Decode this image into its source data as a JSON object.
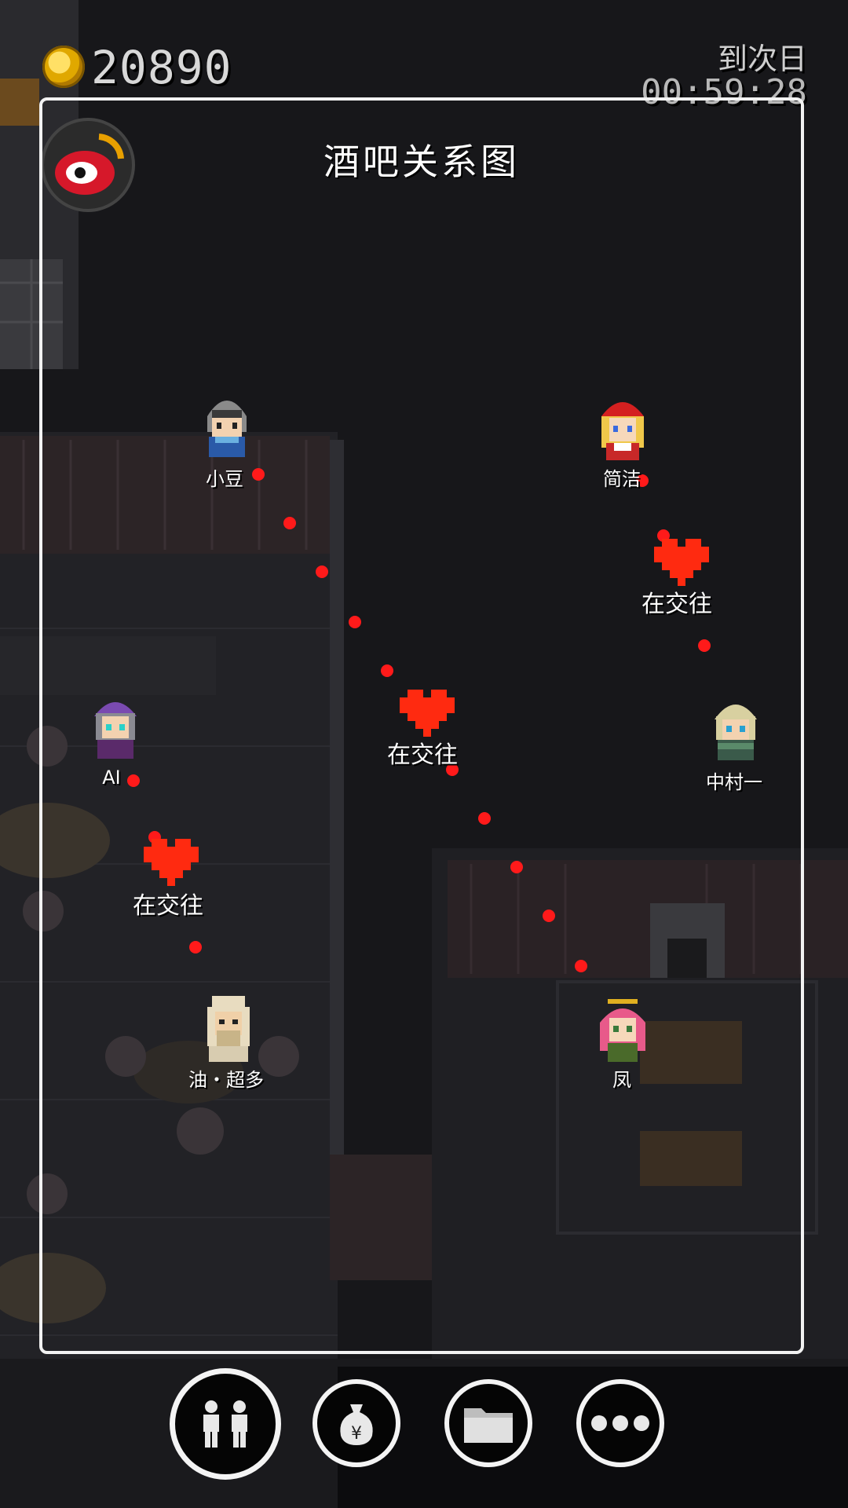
{
  "hud": {
    "coins": "20890",
    "timer_label": "到次日",
    "timer_value": "00:59:28"
  },
  "panel": {
    "title": "酒吧关系图"
  },
  "characters": [
    {
      "name": "小豆"
    },
    {
      "name": "简洁"
    },
    {
      "name": "AI"
    },
    {
      "name": "中村一"
    },
    {
      "name": "油・超多"
    },
    {
      "name": "凤"
    }
  ],
  "relationships": [
    {
      "from": "小豆",
      "to": "凤",
      "label": "在交往"
    },
    {
      "from": "简洁",
      "to": "中村一",
      "label": "在交往"
    },
    {
      "from": "AI",
      "to": "油・超多",
      "label": "在交往"
    }
  ],
  "colors": {
    "link_dot": "#ff1a1a",
    "heart": "#ff2a10",
    "panel_border": "#f2f2f2"
  },
  "toolbar": {
    "buttons": [
      {
        "name": "relationship-button",
        "icon": "people-icon"
      },
      {
        "name": "money-button",
        "icon": "money-bag-icon"
      },
      {
        "name": "folder-button",
        "icon": "folder-icon"
      },
      {
        "name": "more-button",
        "icon": "more-icon"
      }
    ]
  }
}
